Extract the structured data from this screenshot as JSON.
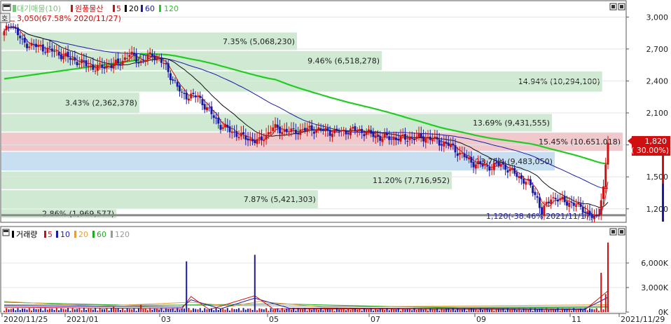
{
  "chart_data": [
    {
      "type": "candlestick",
      "panel": "price",
      "legend": [
        {
          "label": "대기매물(10)",
          "color": "#7fbf7f"
        },
        {
          "label": "원풍물산",
          "color": "#d01010"
        },
        {
          "label": "5",
          "color": "#d01010"
        },
        {
          "label": "20",
          "color": "#000000"
        },
        {
          "label": "60",
          "color": "#1a1aa8"
        },
        {
          "label": "120",
          "color": "#22cc22"
        }
      ],
      "high_annotation": "3,050(67.58% 2020/11/27)",
      "low_annotation": "1,120(-38.46% 2021/11/17)",
      "current_price": "1,820",
      "current_change": "( 30.00%)",
      "ylim": [
        1080,
        3140
      ],
      "y_ticks": [
        {
          "value": 3000,
          "label": "3,000"
        },
        {
          "value": 2700,
          "label": "2,700"
        },
        {
          "value": 2400,
          "label": "2,400"
        },
        {
          "value": 2100,
          "label": "2,100"
        },
        {
          "value": 1800,
          "label": "1,800"
        },
        {
          "value": 1500,
          "label": "1,500"
        },
        {
          "value": 1200,
          "label": "1,200"
        }
      ],
      "volume_profile": [
        {
          "lo": 2690,
          "hi": 2855,
          "pct": 7.35,
          "label": "7.35% (5,068,230)",
          "highlight": "none"
        },
        {
          "lo": 2500,
          "hi": 2680,
          "pct": 9.46,
          "label": "9.46% (6,518,278)",
          "highlight": "none"
        },
        {
          "lo": 2300,
          "hi": 2490,
          "pct": 14.94,
          "label": "14.94% (10,294,100)",
          "highlight": "none"
        },
        {
          "lo": 2100,
          "hi": 2290,
          "pct": 3.43,
          "label": "3.43% (2,362,378)",
          "highlight": "none"
        },
        {
          "lo": 1925,
          "hi": 2090,
          "pct": 13.69,
          "label": "13.69% (9,431,555)",
          "highlight": "none"
        },
        {
          "lo": 1745,
          "hi": 1915,
          "pct": 15.45,
          "label": "15.45% (10,651,018)",
          "highlight": "red"
        },
        {
          "lo": 1560,
          "hi": 1735,
          "pct": 13.76,
          "label": "13.76% (9,483,050)",
          "highlight": "blue"
        },
        {
          "lo": 1385,
          "hi": 1550,
          "pct": 11.2,
          "label": "11.20% (7,716,952)",
          "highlight": "none"
        },
        {
          "lo": 1205,
          "hi": 1375,
          "pct": 7.87,
          "label": "7.87% (5,421,303)",
          "highlight": "none"
        },
        {
          "lo": 1115,
          "hi": 1195,
          "pct": 2.86,
          "label": "2.86% (1,969,577)",
          "highlight": "none"
        }
      ],
      "support_line": 1140
    },
    {
      "type": "bar",
      "panel": "volume",
      "legend": [
        {
          "label": "거래량",
          "color": "#000000"
        },
        {
          "label": "5",
          "color": "#d01010"
        },
        {
          "label": "10",
          "color": "#1a1aa8"
        },
        {
          "label": "20",
          "color": "#e0a040"
        },
        {
          "label": "60",
          "color": "#22aa22"
        },
        {
          "label": "120",
          "color": "#999999"
        }
      ],
      "ylim": [
        0,
        9000
      ],
      "y_ticks": [
        {
          "value": 6000,
          "label": "6,000K"
        },
        {
          "value": 3000,
          "label": "3,000K"
        },
        {
          "value": 0,
          "label": "0K"
        }
      ],
      "spikes": [
        {
          "date": "2021/03/02",
          "value": 6200
        },
        {
          "date": "2021/04/15",
          "value": 7000
        },
        {
          "date": "2021/11/26",
          "value": 4800
        },
        {
          "date": "2021/11/29",
          "value": 8500
        }
      ]
    }
  ],
  "x_axis_labels": [
    "2020/11/25",
    "2021/01",
    "03",
    "05",
    "07",
    "09",
    "11",
    "2021/11/29"
  ]
}
